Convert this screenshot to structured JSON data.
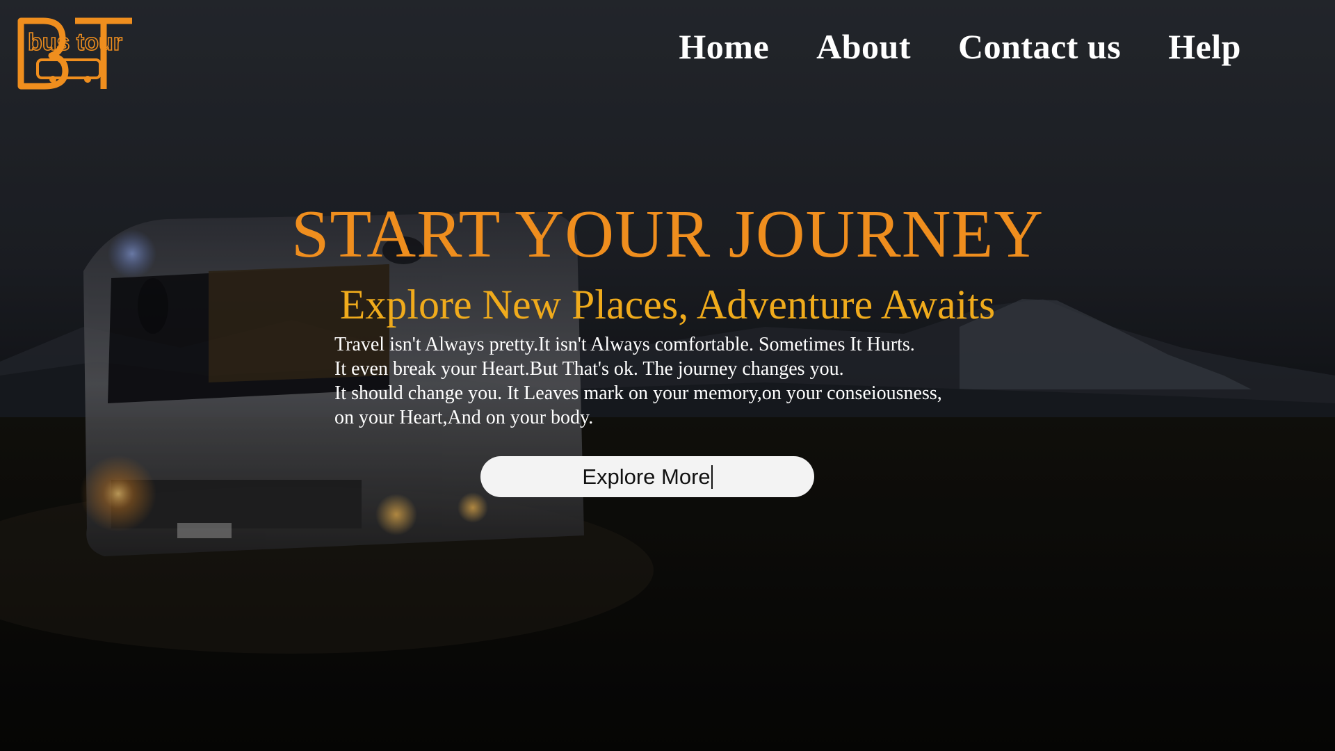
{
  "logo": {
    "text": "bus tour",
    "letters": "BT",
    "color": "#ef8e1e"
  },
  "nav": {
    "items": [
      {
        "label": "Home"
      },
      {
        "label": "About"
      },
      {
        "label": "Contact us"
      },
      {
        "label": "Help"
      }
    ]
  },
  "hero": {
    "title": "START YOUR JOURNEY",
    "subtitle": "Explore New Places, Adventure Awaits",
    "paragraph_lines": [
      "Travel isn't Always pretty.It isn't Always comfortable. Sometimes It Hurts.",
      "It even break your Heart.But That's ok. The journey changes you.",
      "It should change you. It Leaves mark on your memory,on your conseiousness,",
      "on your Heart,And on your body."
    ],
    "button_label": "Explore More"
  },
  "colors": {
    "accent_orange": "#ef8e1e",
    "accent_gold": "#f0ab1c",
    "text_white": "#ffffff",
    "button_bg": "#f3f3f3"
  },
  "background": {
    "description_icon": "bus-at-night-photo"
  }
}
